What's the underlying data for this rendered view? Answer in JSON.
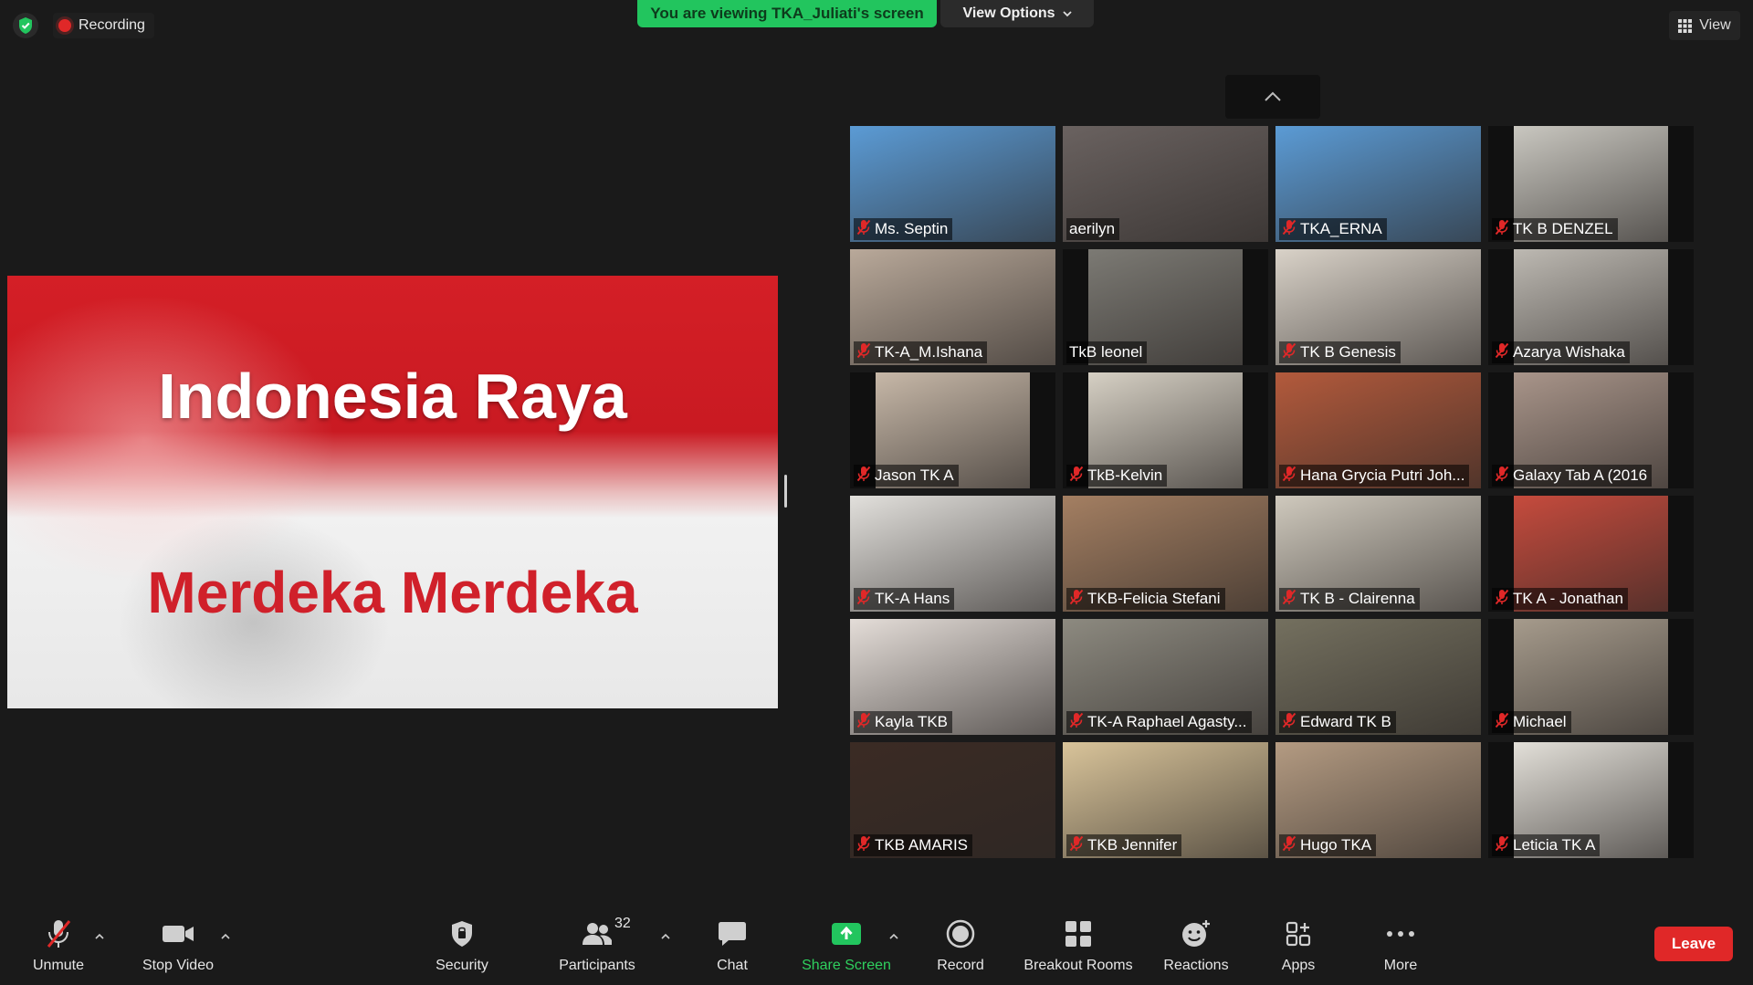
{
  "top_bar": {
    "recording_label": "Recording",
    "viewing_banner": "You are viewing TKA_Juliati's screen",
    "view_options_label": "View Options",
    "view_label": "View"
  },
  "shared_screen": {
    "title": "Indonesia Raya",
    "subtitle": "Merdeka Merdeka"
  },
  "participants": [
    {
      "name": "Ms. Septin",
      "muted": true,
      "bg": "#5b9bd5"
    },
    {
      "name": "aerilyn",
      "muted": false,
      "bg": "#6a6260"
    },
    {
      "name": "TKA_ERNA",
      "muted": true,
      "bg": "#5b9bd5"
    },
    {
      "name": "TK B DENZEL",
      "muted": true,
      "bg": "#c9c7c0"
    },
    {
      "name": "TK-A_M.Ishana",
      "muted": true,
      "bg": "#b9a99a"
    },
    {
      "name": "TkB leonel",
      "muted": false,
      "bg": "#7c7a74"
    },
    {
      "name": "TK B Genesis",
      "muted": true,
      "bg": "#d9d2c8"
    },
    {
      "name": "Azarya Wishaka",
      "muted": true,
      "bg": "#bdb9b2"
    },
    {
      "name": "Jason TK A",
      "muted": true,
      "bg": "#c7b8a8"
    },
    {
      "name": "TkB-Kelvin",
      "muted": true,
      "bg": "#d6d0c4"
    },
    {
      "name": "Hana Grycia Putri Joh...",
      "muted": true,
      "bg": "#b35a3c"
    },
    {
      "name": "Galaxy Tab A (2016",
      "muted": true,
      "bg": "#a9958a"
    },
    {
      "name": "TK-A Hans",
      "muted": true,
      "bg": "#e2e0dc"
    },
    {
      "name": "TKB-Felicia Stefani",
      "muted": true,
      "bg": "#a47f62"
    },
    {
      "name": "TK B - Clairenna",
      "muted": true,
      "bg": "#cfc9bd"
    },
    {
      "name": "TK A - Jonathan",
      "muted": true,
      "bg": "#c64b3d"
    },
    {
      "name": "Kayla TKB",
      "muted": true,
      "bg": "#e4ddd8"
    },
    {
      "name": "TK-A Raphael Agasty...",
      "muted": true,
      "bg": "#8d8a80"
    },
    {
      "name": "Edward TK B",
      "muted": true,
      "bg": "#74705f"
    },
    {
      "name": "Michael",
      "muted": true,
      "bg": "#a69b8c"
    },
    {
      "name": "TKB AMARIS",
      "muted": true,
      "bg": "#3b2b24"
    },
    {
      "name": "TKB Jennifer",
      "muted": true,
      "bg": "#d9c49a"
    },
    {
      "name": "Hugo TKA",
      "muted": true,
      "bg": "#b49b82"
    },
    {
      "name": "Leticia TK A",
      "muted": true,
      "bg": "#e3e0d9"
    }
  ],
  "toolbar": {
    "unmute_label": "Unmute",
    "stop_video_label": "Stop Video",
    "security_label": "Security",
    "participants_label": "Participants",
    "participants_count": "32",
    "chat_label": "Chat",
    "share_screen_label": "Share Screen",
    "record_label": "Record",
    "breakout_label": "Breakout Rooms",
    "reactions_label": "Reactions",
    "apps_label": "Apps",
    "more_label": "More",
    "leave_label": "Leave"
  },
  "colors": {
    "accent_green": "#22c55e",
    "leave_red": "#e02828",
    "background": "#1a1a1a"
  }
}
